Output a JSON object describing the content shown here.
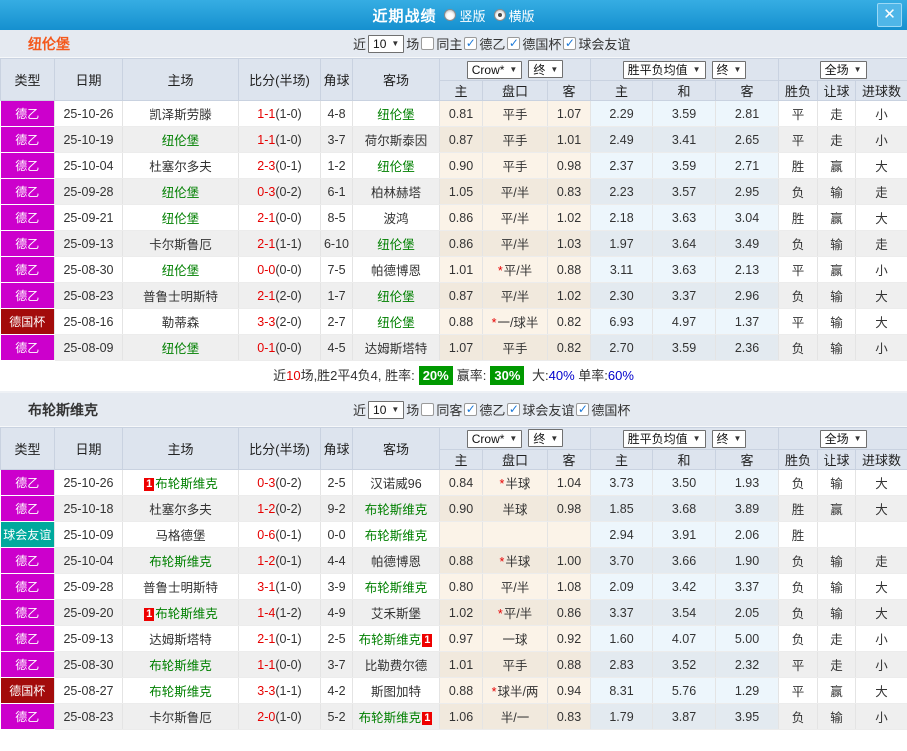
{
  "titlebar": {
    "title": "近期战绩",
    "radio_options": [
      {
        "label": "竖版",
        "selected": false
      },
      {
        "label": "横版",
        "selected": true
      }
    ],
    "close_label": "✕"
  },
  "table": {
    "main_headers": [
      "类型",
      "日期",
      "主场",
      "比分(半场)",
      "角球",
      "客场"
    ],
    "sub_headers": [
      "主",
      "盘口",
      "客",
      "主",
      "和",
      "客",
      "胜负",
      "让球",
      "进球数"
    ],
    "odds_select": "Crow*",
    "odds_final_select": "终",
    "avg_select": "胜平负均值",
    "avg_final_select": "终",
    "scope_select": "全场"
  },
  "colors": {
    "league": {
      "德乙": "#cc00cc",
      "德国杯": "#a30b0b",
      "球会友谊": "#00a99d"
    },
    "target_team": "#008000",
    "res_red": "#d70000",
    "res_green": "#008000",
    "res_blue": "#0000cc"
  },
  "sections": [
    {
      "team": "纽伦堡",
      "team_color": "#f4581c",
      "filters": {
        "prefix": "近",
        "count": "10",
        "suffix": "场",
        "same_venue": {
          "label": "同主",
          "checked": false
        },
        "leagues": [
          {
            "label": "德乙",
            "checked": true
          },
          {
            "label": "德国杯",
            "checked": true
          },
          {
            "label": "球会友谊",
            "checked": true
          }
        ]
      },
      "rows": [
        {
          "league": "德乙",
          "date": "25-10-26",
          "home": "凯泽斯劳滕",
          "home_target": false,
          "home_badge": "",
          "home_badge_after": false,
          "score": "1-1",
          "half": "(1-0)",
          "corners": "4-8",
          "away": "纽伦堡",
          "away_target": true,
          "away_badge": "",
          "away_badge_after": false,
          "star": false,
          "odds": [
            "0.81",
            "平手",
            "1.07"
          ],
          "avg": [
            "2.29",
            "3.59",
            "2.81"
          ],
          "res": [
            "平",
            "走",
            "小"
          ],
          "res_colors": [
            "blue",
            "blue",
            "green"
          ]
        },
        {
          "league": "德乙",
          "date": "25-10-19",
          "home": "纽伦堡",
          "home_target": true,
          "home_badge": "",
          "home_badge_after": false,
          "score": "1-1",
          "half": "(1-0)",
          "corners": "3-7",
          "away": "荷尔斯泰因",
          "away_target": false,
          "away_badge": "",
          "away_badge_after": false,
          "star": false,
          "odds": [
            "0.87",
            "平手",
            "1.01"
          ],
          "avg": [
            "2.49",
            "3.41",
            "2.65"
          ],
          "res": [
            "平",
            "走",
            "小"
          ],
          "res_colors": [
            "blue",
            "blue",
            "green"
          ]
        },
        {
          "league": "德乙",
          "date": "25-10-04",
          "home": "杜塞尔多夫",
          "home_target": false,
          "home_badge": "",
          "home_badge_after": false,
          "score": "2-3",
          "half": "(0-1)",
          "corners": "1-2",
          "away": "纽伦堡",
          "away_target": true,
          "away_badge": "",
          "away_badge_after": false,
          "star": false,
          "odds": [
            "0.90",
            "平手",
            "0.98"
          ],
          "avg": [
            "2.37",
            "3.59",
            "2.71"
          ],
          "res": [
            "胜",
            "赢",
            "大"
          ],
          "res_colors": [
            "red",
            "red",
            "red"
          ]
        },
        {
          "league": "德乙",
          "date": "25-09-28",
          "home": "纽伦堡",
          "home_target": true,
          "home_badge": "",
          "home_badge_after": false,
          "score": "0-3",
          "half": "(0-2)",
          "corners": "6-1",
          "away": "柏林赫塔",
          "away_target": false,
          "away_badge": "",
          "away_badge_after": false,
          "star": false,
          "odds": [
            "1.05",
            "平/半",
            "0.83"
          ],
          "avg": [
            "2.23",
            "3.57",
            "2.95"
          ],
          "res": [
            "负",
            "输",
            "走"
          ],
          "res_colors": [
            "green",
            "green",
            "blue"
          ]
        },
        {
          "league": "德乙",
          "date": "25-09-21",
          "home": "纽伦堡",
          "home_target": true,
          "home_badge": "",
          "home_badge_after": false,
          "score": "2-1",
          "half": "(0-0)",
          "corners": "8-5",
          "away": "波鸿",
          "away_target": false,
          "away_badge": "",
          "away_badge_after": false,
          "star": false,
          "odds": [
            "0.86",
            "平/半",
            "1.02"
          ],
          "avg": [
            "2.18",
            "3.63",
            "3.04"
          ],
          "res": [
            "胜",
            "赢",
            "大"
          ],
          "res_colors": [
            "red",
            "red",
            "red"
          ]
        },
        {
          "league": "德乙",
          "date": "25-09-13",
          "home": "卡尔斯鲁厄",
          "home_target": false,
          "home_badge": "",
          "home_badge_after": false,
          "score": "2-1",
          "half": "(1-1)",
          "corners": "6-10",
          "away": "纽伦堡",
          "away_target": true,
          "away_badge": "",
          "away_badge_after": false,
          "star": false,
          "odds": [
            "0.86",
            "平/半",
            "1.03"
          ],
          "avg": [
            "1.97",
            "3.64",
            "3.49"
          ],
          "res": [
            "负",
            "输",
            "走"
          ],
          "res_colors": [
            "green",
            "green",
            "blue"
          ]
        },
        {
          "league": "德乙",
          "date": "25-08-30",
          "home": "纽伦堡",
          "home_target": true,
          "home_badge": "",
          "home_badge_after": false,
          "score": "0-0",
          "half": "(0-0)",
          "corners": "7-5",
          "away": "帕德博恩",
          "away_target": false,
          "away_badge": "",
          "away_badge_after": false,
          "star": true,
          "odds": [
            "1.01",
            "平/半",
            "0.88"
          ],
          "avg": [
            "3.11",
            "3.63",
            "2.13"
          ],
          "res": [
            "平",
            "赢",
            "小"
          ],
          "res_colors": [
            "blue",
            "red",
            "green"
          ]
        },
        {
          "league": "德乙",
          "date": "25-08-23",
          "home": "普鲁士明斯特",
          "home_target": false,
          "home_badge": "",
          "home_badge_after": false,
          "score": "2-1",
          "half": "(2-0)",
          "corners": "1-7",
          "away": "纽伦堡",
          "away_target": true,
          "away_badge": "",
          "away_badge_after": false,
          "star": false,
          "odds": [
            "0.87",
            "平/半",
            "1.02"
          ],
          "avg": [
            "2.30",
            "3.37",
            "2.96"
          ],
          "res": [
            "负",
            "输",
            "大"
          ],
          "res_colors": [
            "green",
            "green",
            "red"
          ]
        },
        {
          "league": "德国杯",
          "date": "25-08-16",
          "home": "勒蒂森",
          "home_target": false,
          "home_badge": "",
          "home_badge_after": false,
          "score": "3-3",
          "half": "(2-0)",
          "corners": "2-7",
          "away": "纽伦堡",
          "away_target": true,
          "away_badge": "",
          "away_badge_after": false,
          "star": true,
          "odds": [
            "0.88",
            "一/球半",
            "0.82"
          ],
          "avg": [
            "6.93",
            "4.97",
            "1.37"
          ],
          "res": [
            "平",
            "输",
            "大"
          ],
          "res_colors": [
            "blue",
            "green",
            "red"
          ]
        },
        {
          "league": "德乙",
          "date": "25-08-09",
          "home": "纽伦堡",
          "home_target": true,
          "home_badge": "",
          "home_badge_after": false,
          "score": "0-1",
          "half": "(0-0)",
          "corners": "4-5",
          "away": "达姆斯塔特",
          "away_target": false,
          "away_badge": "",
          "away_badge_after": false,
          "star": false,
          "odds": [
            "1.07",
            "平手",
            "0.82"
          ],
          "avg": [
            "2.70",
            "3.59",
            "2.36"
          ],
          "res": [
            "负",
            "输",
            "小"
          ],
          "res_colors": [
            "green",
            "green",
            "green"
          ]
        }
      ],
      "summary": {
        "seg1": "近",
        "red": "10",
        "seg2": "场,胜2平4负4, 胜率:",
        "badge1": "20%",
        "seg3": "赢率:",
        "badge2": "30%",
        "seg4": "大:",
        "blue1": "40%",
        "seg5": "单率:",
        "blue2": "60%"
      }
    },
    {
      "team": "布轮斯维克",
      "team_color": "#333333",
      "filters": {
        "prefix": "近",
        "count": "10",
        "suffix": "场",
        "same_venue": {
          "label": "同客",
          "checked": false
        },
        "leagues": [
          {
            "label": "德乙",
            "checked": true
          },
          {
            "label": "球会友谊",
            "checked": true
          },
          {
            "label": "德国杯",
            "checked": true
          }
        ]
      },
      "rows": [
        {
          "league": "德乙",
          "date": "25-10-26",
          "home": "布轮斯维克",
          "home_target": true,
          "home_badge": "1",
          "home_badge_after": false,
          "score": "0-3",
          "half": "(0-2)",
          "corners": "2-5",
          "away": "汉诺威96",
          "away_target": false,
          "away_badge": "",
          "away_badge_after": false,
          "star": true,
          "odds": [
            "0.84",
            "半球",
            "1.04"
          ],
          "avg": [
            "3.73",
            "3.50",
            "1.93"
          ],
          "res": [
            "负",
            "输",
            "大"
          ],
          "res_colors": [
            "green",
            "green",
            "red"
          ]
        },
        {
          "league": "德乙",
          "date": "25-10-18",
          "home": "杜塞尔多夫",
          "home_target": false,
          "home_badge": "",
          "home_badge_after": false,
          "score": "1-2",
          "half": "(0-2)",
          "corners": "9-2",
          "away": "布轮斯维克",
          "away_target": true,
          "away_badge": "",
          "away_badge_after": false,
          "star": false,
          "odds": [
            "0.90",
            "半球",
            "0.98"
          ],
          "avg": [
            "1.85",
            "3.68",
            "3.89"
          ],
          "res": [
            "胜",
            "赢",
            "大"
          ],
          "res_colors": [
            "red",
            "red",
            "red"
          ]
        },
        {
          "league": "球会友谊",
          "date": "25-10-09",
          "home": "马格德堡",
          "home_target": false,
          "home_badge": "",
          "home_badge_after": false,
          "score": "0-6",
          "half": "(0-1)",
          "corners": "0-0",
          "away": "布轮斯维克",
          "away_target": true,
          "away_badge": "",
          "away_badge_after": false,
          "star": false,
          "odds": [
            "",
            "",
            ""
          ],
          "avg": [
            "2.94",
            "3.91",
            "2.06"
          ],
          "res": [
            "胜",
            "",
            ""
          ],
          "res_colors": [
            "red",
            "",
            ""
          ]
        },
        {
          "league": "德乙",
          "date": "25-10-04",
          "home": "布轮斯维克",
          "home_target": true,
          "home_badge": "",
          "home_badge_after": false,
          "score": "1-2",
          "half": "(0-1)",
          "corners": "4-4",
          "away": "帕德博恩",
          "away_target": false,
          "away_badge": "",
          "away_badge_after": false,
          "star": true,
          "odds": [
            "0.88",
            "半球",
            "1.00"
          ],
          "avg": [
            "3.70",
            "3.66",
            "1.90"
          ],
          "res": [
            "负",
            "输",
            "走"
          ],
          "res_colors": [
            "green",
            "green",
            "blue"
          ]
        },
        {
          "league": "德乙",
          "date": "25-09-28",
          "home": "普鲁士明斯特",
          "home_target": false,
          "home_badge": "",
          "home_badge_after": false,
          "score": "3-1",
          "half": "(1-0)",
          "corners": "3-9",
          "away": "布轮斯维克",
          "away_target": true,
          "away_badge": "",
          "away_badge_after": false,
          "star": false,
          "odds": [
            "0.80",
            "平/半",
            "1.08"
          ],
          "avg": [
            "2.09",
            "3.42",
            "3.37"
          ],
          "res": [
            "负",
            "输",
            "大"
          ],
          "res_colors": [
            "green",
            "green",
            "red"
          ]
        },
        {
          "league": "德乙",
          "date": "25-09-20",
          "home": "布轮斯维克",
          "home_target": true,
          "home_badge": "1",
          "home_badge_after": false,
          "score": "1-4",
          "half": "(1-2)",
          "corners": "4-9",
          "away": "艾禾斯堡",
          "away_target": false,
          "away_badge": "",
          "away_badge_after": false,
          "star": true,
          "odds": [
            "1.02",
            "平/半",
            "0.86"
          ],
          "avg": [
            "3.37",
            "3.54",
            "2.05"
          ],
          "res": [
            "负",
            "输",
            "大"
          ],
          "res_colors": [
            "green",
            "green",
            "red"
          ]
        },
        {
          "league": "德乙",
          "date": "25-09-13",
          "home": "达姆斯塔特",
          "home_target": false,
          "home_badge": "",
          "home_badge_after": false,
          "score": "2-1",
          "half": "(0-1)",
          "corners": "2-5",
          "away": "布轮斯维克",
          "away_target": true,
          "away_badge": "1",
          "away_badge_after": true,
          "star": false,
          "odds": [
            "0.97",
            "一球",
            "0.92"
          ],
          "avg": [
            "1.60",
            "4.07",
            "5.00"
          ],
          "res": [
            "负",
            "走",
            "小"
          ],
          "res_colors": [
            "green",
            "blue",
            "green"
          ]
        },
        {
          "league": "德乙",
          "date": "25-08-30",
          "home": "布轮斯维克",
          "home_target": true,
          "home_badge": "",
          "home_badge_after": false,
          "score": "1-1",
          "half": "(0-0)",
          "corners": "3-7",
          "away": "比勒费尔德",
          "away_target": false,
          "away_badge": "",
          "away_badge_after": false,
          "star": false,
          "odds": [
            "1.01",
            "平手",
            "0.88"
          ],
          "avg": [
            "2.83",
            "3.52",
            "2.32"
          ],
          "res": [
            "平",
            "走",
            "小"
          ],
          "res_colors": [
            "blue",
            "blue",
            "green"
          ]
        },
        {
          "league": "德国杯",
          "date": "25-08-27",
          "home": "布轮斯维克",
          "home_target": true,
          "home_badge": "",
          "home_badge_after": false,
          "score": "3-3",
          "half": "(1-1)",
          "corners": "4-2",
          "away": "斯图加特",
          "away_target": false,
          "away_badge": "",
          "away_badge_after": false,
          "star": true,
          "odds": [
            "0.88",
            "球半/两",
            "0.94"
          ],
          "avg": [
            "8.31",
            "5.76",
            "1.29"
          ],
          "res": [
            "平",
            "赢",
            "大"
          ],
          "res_colors": [
            "blue",
            "red",
            "red"
          ]
        },
        {
          "league": "德乙",
          "date": "25-08-23",
          "home": "卡尔斯鲁厄",
          "home_target": false,
          "home_badge": "",
          "home_badge_after": false,
          "score": "2-0",
          "half": "(1-0)",
          "corners": "5-2",
          "away": "布轮斯维克",
          "away_target": true,
          "away_badge": "1",
          "away_badge_after": true,
          "star": false,
          "odds": [
            "1.06",
            "半/一",
            "0.83"
          ],
          "avg": [
            "1.79",
            "3.87",
            "3.95"
          ],
          "res": [
            "负",
            "输",
            "小"
          ],
          "res_colors": [
            "green",
            "green",
            "green"
          ]
        }
      ],
      "summary": null
    }
  ]
}
